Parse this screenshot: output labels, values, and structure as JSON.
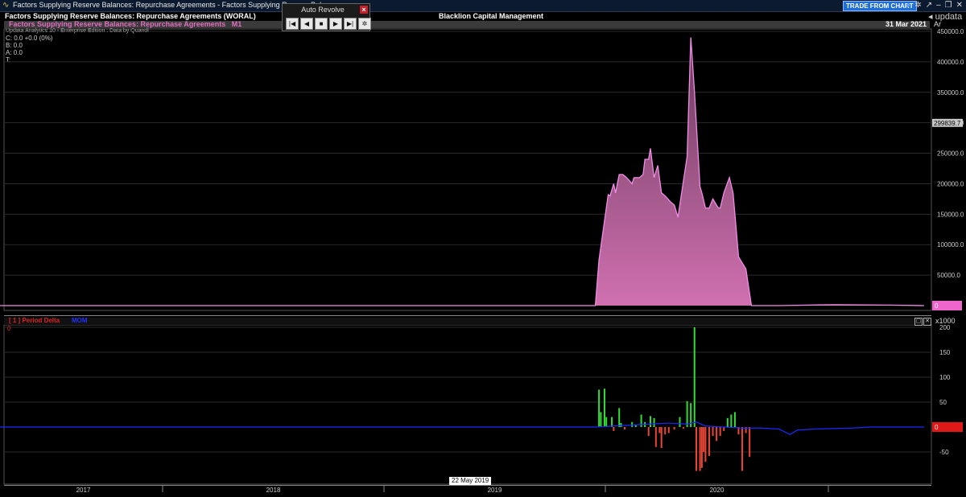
{
  "window": {
    "title": "Factors Supplying Reserve Balances: Repurchase Agreements - Factors Supplying Reserve Bala",
    "trade_button": "TRADE FROM CHART",
    "logo": "updata"
  },
  "header": {
    "chart_title": "Factors Supplying Reserve Balances: Repurchase Agreements (WORAL)",
    "company": "Blacklion Capital Management"
  },
  "auto_revolve": {
    "title": "Auto Revolve",
    "close": "×",
    "buttons": [
      "|◀",
      "◀",
      "■",
      "▶",
      "▶|",
      "✲"
    ]
  },
  "panel": {
    "series_name": "Factors Supplying Reserve Balances: Repurchase Agreements",
    "timeframe": "M1",
    "date": "31 Mar 2021",
    "ar_label": "Ar"
  },
  "info": {
    "edition": "Updata Analytics 10 - Enterprise Edition : Data by Quandl",
    "close": "C: 0.0  +0.0 (0%)",
    "bid": "B: 0.0",
    "ask": "A: 0.0",
    "time": "T:"
  },
  "lower_panel": {
    "indicator": "[ 1 ] Period Delta",
    "mom": "MOM",
    "zero_label": "0",
    "scale": "x1000"
  },
  "cursor_date": "22 May 2019",
  "colors": {
    "main_line": "#f08ce6",
    "main_fill_top": "#6a3b5c",
    "main_fill_bottom": "#d070b0",
    "positive_bar": "#33dd33",
    "negative_bar": "#ee4433",
    "mom_line": "#1a2aff",
    "last_value_tag": "#c8c8c8",
    "zero_tag": "#ee66cc",
    "lower_zero_tag": "#e01818"
  },
  "chart_data": [
    {
      "type": "area",
      "title": "Factors Supplying Reserve Balances: Repurchase Agreements",
      "x_ticks": [
        "2017",
        "2018",
        "2019",
        "2020"
      ],
      "y_ticks": [
        0,
        50000,
        100000,
        150000,
        200000,
        250000,
        300000,
        350000,
        400000,
        450000
      ],
      "ylim": [
        0,
        450000
      ],
      "last_value_label": "299839.7",
      "zero_label": "0",
      "grid": true,
      "series": [
        {
          "x": [
            2016.0,
            2019.7,
            2019.72,
            2019.77,
            2019.78,
            2019.8,
            2019.81,
            2019.83,
            2019.85,
            2019.87,
            2019.9,
            2019.91,
            2019.94,
            2019.96,
            2019.97,
            2019.99,
            2020.0,
            2020.02,
            2020.04,
            2020.06,
            2020.08,
            2020.11,
            2020.13,
            2020.15,
            2020.18,
            2020.2,
            2020.22,
            2020.24,
            2020.27,
            2020.28,
            2020.3,
            2020.32,
            2020.34,
            2020.37,
            2020.38,
            2020.4,
            2020.43,
            2020.45,
            2020.48,
            2020.5,
            2020.52,
            2020.55,
            2020.57,
            2020.58,
            2020.6,
            2020.62,
            2020.64,
            2020.7,
            2021.0,
            2021.3,
            2021.49
          ],
          "y": [
            0,
            0,
            75000,
            182000,
            180000,
            200000,
            185000,
            215000,
            215000,
            210000,
            200000,
            210000,
            210000,
            215000,
            240000,
            240000,
            258000,
            210000,
            230000,
            185000,
            180000,
            170000,
            165000,
            145000,
            205000,
            245000,
            440000,
            350000,
            195000,
            185000,
            160000,
            160000,
            175000,
            160000,
            160000,
            185000,
            210000,
            185000,
            80000,
            70000,
            60000,
            0,
            0,
            0,
            0,
            0,
            0,
            0,
            1500,
            800,
            0
          ]
        }
      ]
    },
    {
      "type": "bar",
      "title": "Period Delta",
      "ylabel": "x1000",
      "y_ticks": [
        -50,
        0,
        50,
        100,
        150,
        200
      ],
      "ylim": [
        -95,
        200
      ],
      "zero_label": "0",
      "bars": {
        "x": [
          2019.72,
          2019.73,
          2019.75,
          2019.76,
          2019.79,
          2019.8,
          2019.83,
          2019.84,
          2019.86,
          2019.9,
          2019.92,
          2019.95,
          2019.97,
          2019.99,
          2020.0,
          2020.02,
          2020.03,
          2020.05,
          2020.06,
          2020.08,
          2020.1,
          2020.13,
          2020.16,
          2020.18,
          2020.2,
          2020.22,
          2020.24,
          2020.25,
          2020.27,
          2020.28,
          2020.29,
          2020.3,
          2020.32,
          2020.34,
          2020.36,
          2020.38,
          2020.4,
          2020.42,
          2020.44,
          2020.46,
          2020.48,
          2020.5,
          2020.52,
          2020.54
        ],
        "values": [
          75,
          30,
          77,
          20,
          20,
          -8,
          38,
          8,
          -5,
          10,
          5,
          25,
          10,
          -18,
          22,
          18,
          -40,
          -12,
          -42,
          -15,
          -12,
          -5,
          20,
          -3,
          52,
          48,
          200,
          -88,
          -88,
          -82,
          -50,
          -70,
          -58,
          -18,
          -28,
          -18,
          -8,
          18,
          25,
          30,
          -15,
          -88,
          -12,
          -60
        ]
      },
      "series": [
        {
          "name": "MOM",
          "x": [
            2016.0,
            2019.7,
            2019.8,
            2019.9,
            2020.0,
            2020.1,
            2020.2,
            2020.25,
            2020.3,
            2020.5,
            2020.6,
            2020.7,
            2020.76,
            2020.8,
            2020.9,
            2021.0,
            2021.1,
            2021.2,
            2021.49
          ],
          "y": [
            0,
            0,
            2,
            4,
            6,
            8,
            6,
            10,
            2,
            -2,
            -2,
            -4,
            -15,
            -6,
            -4,
            -3,
            -2,
            0,
            0
          ]
        }
      ]
    }
  ]
}
